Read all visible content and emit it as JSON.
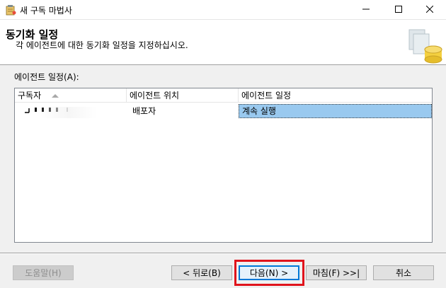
{
  "window": {
    "title": "새 구독 마법사",
    "icon": "wizard-app-icon"
  },
  "header": {
    "title": "동기화 일정",
    "description": "각 에이전트에 대한 동기화 일정을 지정하십시오."
  },
  "schedule_section": {
    "label": "에이전트 일정(A):"
  },
  "grid": {
    "columns": [
      "구독자",
      "에이전트 위치",
      "에이전트 일정"
    ],
    "sorted_column": "구독자",
    "rows": [
      {
        "subscriber": "",
        "agent_location": "배포자",
        "agent_schedule": "계속 실행"
      }
    ]
  },
  "buttons": {
    "help": "도움말(H)",
    "back": "< 뒤로(B)",
    "next": "다음(N) >",
    "finish": "마침(F) >>|",
    "cancel": "취소"
  },
  "colors": {
    "selection": "#99c9ef",
    "highlight_box": "#e0141c",
    "default_button_border": "#0078d7"
  }
}
